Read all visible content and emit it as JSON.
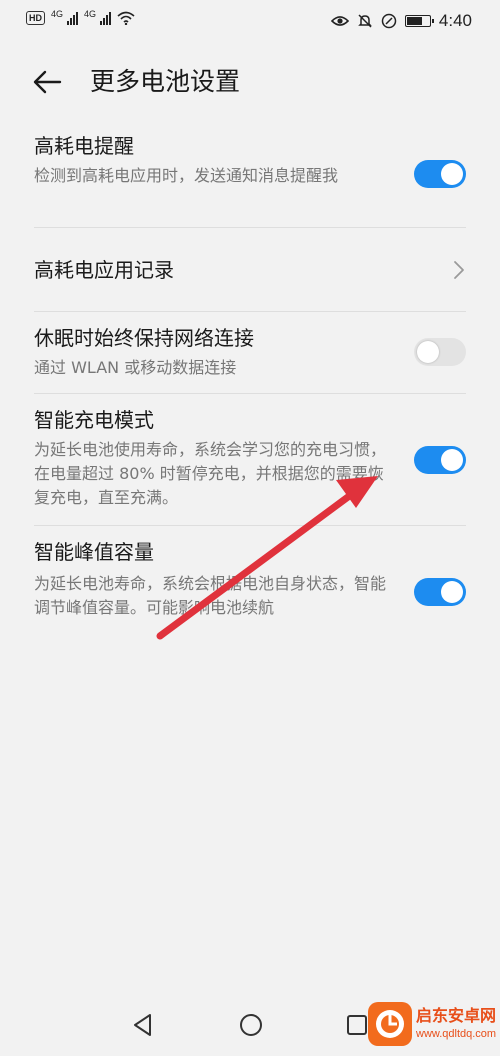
{
  "status_bar": {
    "left_badges": [
      "HD",
      "4G",
      "4G"
    ],
    "time": "4:40",
    "battery_level": 0.7,
    "icons": [
      "eye-comfort-icon",
      "mute-icon",
      "nfc-icon",
      "battery-icon"
    ]
  },
  "header": {
    "title": "更多电池设置",
    "back_icon": "arrow-left-icon"
  },
  "settings": [
    {
      "title": "高耗电提醒",
      "description": "检测到高耗电应用时，发送通知消息提醒我",
      "control": "toggle",
      "checked": true
    },
    {
      "title": "高耗电应用记录",
      "description": "",
      "control": "chevron"
    },
    {
      "title": "休眠时始终保持网络连接",
      "description": "通过 WLAN 或移动数据连接",
      "control": "toggle",
      "checked": false
    },
    {
      "title": "智能充电模式",
      "description": "为延长电池使用寿命，系统会学习您的充电习惯，在电量超过 80% 时暂停充电，并根据您的需要恢复充电，直至充满。",
      "control": "toggle",
      "checked": true
    },
    {
      "title": "智能峰值容量",
      "description": "为延长电池寿命，系统会根据电池自身状态，智能调节峰值容量。可能影响电池续航",
      "control": "toggle",
      "checked": true
    }
  ],
  "navigation": {
    "back": "triangle-back-icon",
    "home": "circle-home-icon",
    "recents": "square-recents-icon"
  },
  "watermark": {
    "name": "启东安卓网",
    "url": "www.qdltdq.com"
  },
  "colors": {
    "accent": "#1d8cf0",
    "annotation_arrow": "#e0323c",
    "background": "#f2f2f2"
  }
}
